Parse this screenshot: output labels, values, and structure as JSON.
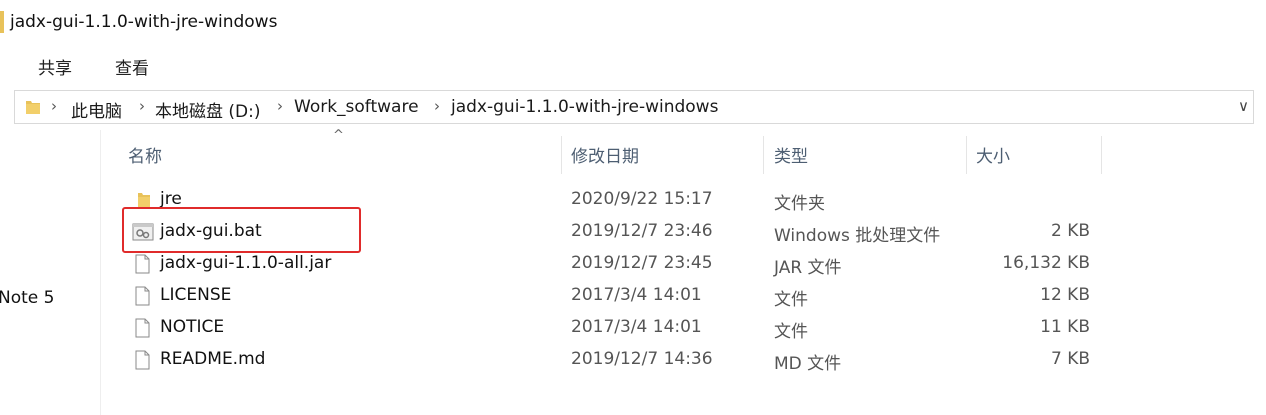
{
  "window": {
    "title": "jadx-gui-1.1.0-with-jre-windows"
  },
  "ribbon": {
    "tabs": [
      "共享",
      "查看"
    ]
  },
  "address_bar": {
    "crumbs": [
      "此电脑",
      "本地磁盘 (D:)",
      "Work_software",
      "jadx-gui-1.1.0-with-jre-windows"
    ]
  },
  "nav_pane": {
    "visible_item": "Note 5"
  },
  "columns": {
    "name": "名称",
    "date": "修改日期",
    "type": "类型",
    "size": "大小"
  },
  "files": [
    {
      "name": "jre",
      "date": "2020/9/22 15:17",
      "type": "文件夹",
      "size": "",
      "icon": "folder-icon"
    },
    {
      "name": "jadx-gui.bat",
      "date": "2019/12/7 23:46",
      "type": "Windows 批处理文件",
      "size": "2 KB",
      "icon": "batch-file-icon"
    },
    {
      "name": "jadx-gui-1.1.0-all.jar",
      "date": "2019/12/7 23:45",
      "type": "JAR 文件",
      "size": "16,132 KB",
      "icon": "file-icon"
    },
    {
      "name": "LICENSE",
      "date": "2017/3/4 14:01",
      "type": "文件",
      "size": "12 KB",
      "icon": "file-icon"
    },
    {
      "name": "NOTICE",
      "date": "2017/3/4 14:01",
      "type": "文件",
      "size": "11 KB",
      "icon": "file-icon"
    },
    {
      "name": "README.md",
      "date": "2019/12/7 14:36",
      "type": "MD 文件",
      "size": "7 KB",
      "icon": "file-icon"
    }
  ],
  "colors": {
    "highlight": "#e02b2b",
    "folder": "#e8c25a",
    "header_text": "#4d5e72"
  }
}
